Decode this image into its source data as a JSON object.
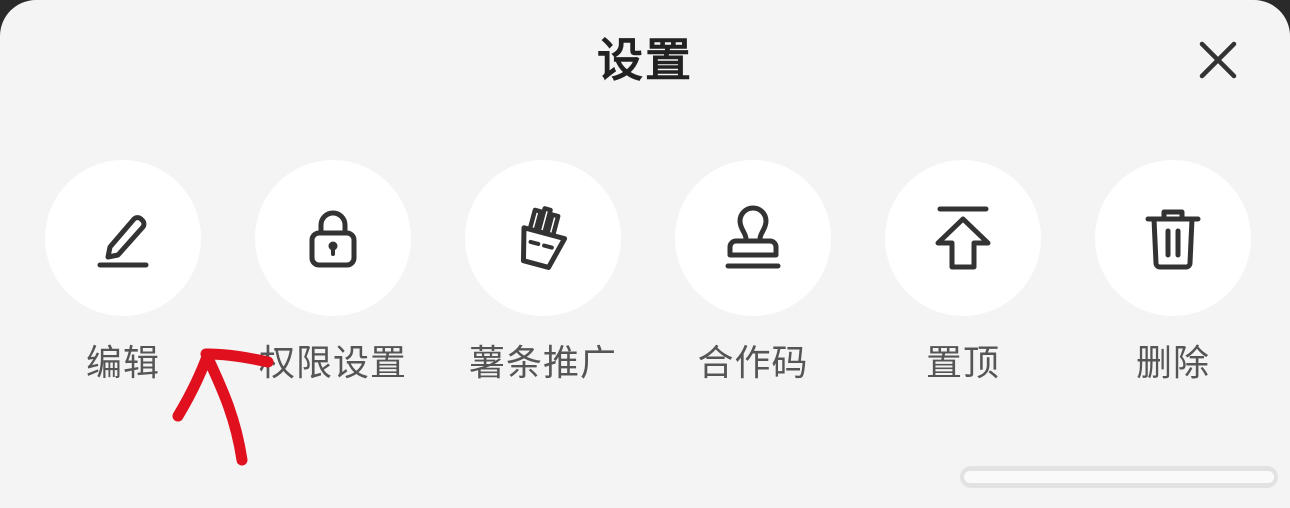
{
  "sheet": {
    "title": "设置",
    "close_icon": "close-icon"
  },
  "actions": [
    {
      "label": "编辑",
      "icon": "pencil-icon"
    },
    {
      "label": "权限设置",
      "icon": "lock-icon"
    },
    {
      "label": "薯条推广",
      "icon": "fries-icon"
    },
    {
      "label": "合作码",
      "icon": "stamp-icon"
    },
    {
      "label": "置顶",
      "icon": "pin-to-top-icon"
    },
    {
      "label": "删除",
      "icon": "trash-icon"
    }
  ],
  "colors": {
    "sheet_background": "#f4f4f4",
    "circle_background": "#ffffff",
    "icon_stroke": "#333333",
    "label_text": "#555555",
    "annotation": "#e0101e"
  }
}
